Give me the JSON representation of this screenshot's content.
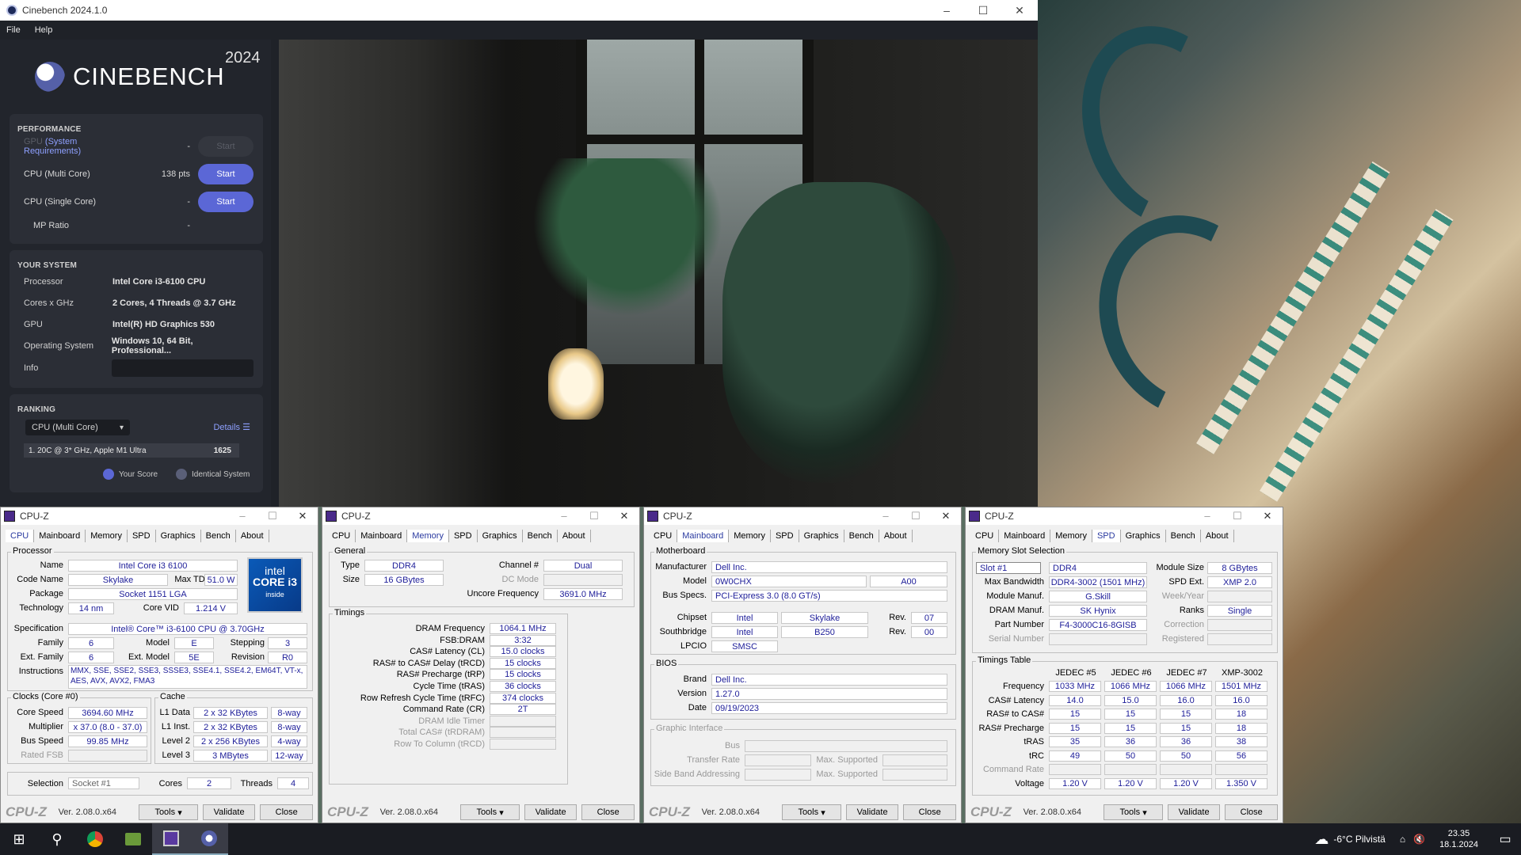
{
  "cinebench": {
    "window_title": "Cinebench 2024.1.0",
    "menu": [
      "File",
      "Help"
    ],
    "logo_text": "CINEBENCH",
    "logo_year": "2024",
    "performance": {
      "heading": "PERFORMANCE",
      "gpu_label": "GPU",
      "gpu_link": "(System Requirements)",
      "gpu_value": "-",
      "gpu_button": "Start",
      "multi_label": "CPU (Multi Core)",
      "multi_value": "138 pts",
      "multi_button": "Start",
      "single_label": "CPU (Single Core)",
      "single_value": "-",
      "single_button": "Start",
      "mp_label": "MP Ratio",
      "mp_value": "-"
    },
    "system": {
      "heading": "YOUR SYSTEM",
      "rows": [
        {
          "k": "Processor",
          "v": "Intel Core i3-6100 CPU"
        },
        {
          "k": "Cores x GHz",
          "v": "2 Cores, 4 Threads @ 3.7 GHz"
        },
        {
          "k": "GPU",
          "v": "Intel(R) HD Graphics 530"
        },
        {
          "k": "Operating System",
          "v": "Windows 10, 64 Bit, Professional..."
        }
      ],
      "info_label": "Info"
    },
    "ranking": {
      "heading": "RANKING",
      "dropdown": "CPU (Multi Core)",
      "details": "Details",
      "row_label": "1. 20C @ 3* GHz, Apple M1 Ultra",
      "row_score": "1625",
      "legend_your": "Your Score",
      "legend_identical": "Identical System",
      "color_your": "#5b67d6",
      "color_identical": "#5a5f78"
    }
  },
  "cpuz": {
    "title": "CPU-Z",
    "version": "Ver. 2.08.0.x64",
    "tools": "Tools",
    "validate": "Validate",
    "close": "Close",
    "tabs": [
      "CPU",
      "Mainboard",
      "Memory",
      "SPD",
      "Graphics",
      "Bench",
      "About"
    ],
    "cpu": {
      "processor_group": "Processor",
      "name_l": "Name",
      "name": "Intel Core i3 6100",
      "codename_l": "Code Name",
      "codename": "Skylake",
      "maxtdp_l": "Max TDP",
      "maxtdp": "51.0 W",
      "package_l": "Package",
      "package": "Socket 1151 LGA",
      "tech_l": "Technology",
      "tech": "14 nm",
      "corevid_l": "Core VID",
      "corevid": "1.214 V",
      "spec_l": "Specification",
      "spec": "Intel® Core™ i3-6100 CPU @ 3.70GHz",
      "family_l": "Family",
      "family": "6",
      "model_l": "Model",
      "model": "E",
      "stepping_l": "Stepping",
      "stepping": "3",
      "extfam_l": "Ext. Family",
      "extfam": "6",
      "extmodel_l": "Ext. Model",
      "extmodel": "5E",
      "revision_l": "Revision",
      "revision": "R0",
      "instr_l": "Instructions",
      "instr1": "MMX, SSE, SSE2, SSE3, SSSE3, SSE4.1, SSE4.2, EM64T, VT-x,",
      "instr2": "AES, AVX, AVX2, FMA3",
      "clocks_group": "Clocks (Core #0)",
      "corespeed_l": "Core Speed",
      "corespeed": "3694.60 MHz",
      "mult_l": "Multiplier",
      "mult": "x 37.0 (8.0 - 37.0)",
      "bus_l": "Bus Speed",
      "bus": "99.85 MHz",
      "fsb_l": "Rated FSB",
      "cache_group": "Cache",
      "l1d_l": "L1 Data",
      "l1d": "2 x 32 KBytes",
      "l1d_w": "8-way",
      "l1i_l": "L1 Inst.",
      "l1i": "2 x 32 KBytes",
      "l1i_w": "8-way",
      "l2_l": "Level 2",
      "l2": "2 x 256 KBytes",
      "l2_w": "4-way",
      "l3_l": "Level 3",
      "l3": "3 MBytes",
      "l3_w": "12-way",
      "sel_l": "Selection",
      "sel": "Socket #1",
      "cores_l": "Cores",
      "cores": "2",
      "threads_l": "Threads",
      "threads": "4",
      "logo_line1": "intel",
      "logo_line2": "CORE i3",
      "logo_line3": "inside"
    },
    "memory": {
      "general_group": "General",
      "type_l": "Type",
      "type": "DDR4",
      "channel_l": "Channel #",
      "channel": "Dual",
      "size_l": "Size",
      "size": "16 GBytes",
      "dc_l": "DC Mode",
      "uncore_l": "Uncore Frequency",
      "uncore": "3691.0 MHz",
      "timings_group": "Timings",
      "rows": [
        {
          "l": "DRAM Frequency",
          "v": "1064.1 MHz"
        },
        {
          "l": "FSB:DRAM",
          "v": "3:32"
        },
        {
          "l": "CAS# Latency (CL)",
          "v": "15.0 clocks"
        },
        {
          "l": "RAS# to CAS# Delay (tRCD)",
          "v": "15 clocks"
        },
        {
          "l": "RAS# Precharge (tRP)",
          "v": "15 clocks"
        },
        {
          "l": "Cycle Time (tRAS)",
          "v": "36 clocks"
        },
        {
          "l": "Row Refresh Cycle Time (tRFC)",
          "v": "374 clocks"
        },
        {
          "l": "Command Rate (CR)",
          "v": "2T"
        },
        {
          "l": "DRAM Idle Timer",
          "v": ""
        },
        {
          "l": "Total CAS# (tRDRAM)",
          "v": ""
        },
        {
          "l": "Row To Column (tRCD)",
          "v": ""
        }
      ]
    },
    "mainboard": {
      "mb_group": "Motherboard",
      "manuf_l": "Manufacturer",
      "manuf": "Dell Inc.",
      "model_l": "Model",
      "model": "0W0CHX",
      "model_rev": "A00",
      "busspec_l": "Bus Specs.",
      "busspec": "PCI-Express 3.0 (8.0 GT/s)",
      "chipset_l": "Chipset",
      "chipset": "Intel",
      "chipset2": "Skylake",
      "rev_l": "Rev.",
      "chipset_rev": "07",
      "south_l": "Southbridge",
      "south": "Intel",
      "south2": "B250",
      "south_rev": "00",
      "lpcio_l": "LPCIO",
      "lpcio": "SMSC",
      "bios_group": "BIOS",
      "brand_l": "Brand",
      "brand": "Dell Inc.",
      "ver_l": "Version",
      "ver": "1.27.0",
      "date_l": "Date",
      "date": "09/19/2023",
      "gi_group": "Graphic Interface",
      "gi_bus": "Bus",
      "gi_tr": "Transfer Rate",
      "gi_ms": "Max. Supported",
      "gi_sba": "Side Band Addressing"
    },
    "spd": {
      "slot_group": "Memory Slot Selection",
      "slot": "Slot #1",
      "type": "DDR4",
      "modsize_l": "Module Size",
      "modsize": "8 GBytes",
      "maxbw_l": "Max Bandwidth",
      "maxbw": "DDR4-3002 (1501 MHz)",
      "spdext_l": "SPD Ext.",
      "spdext": "XMP 2.0",
      "modmanuf_l": "Module Manuf.",
      "modmanuf": "G.Skill",
      "week_l": "Week/Year",
      "drammanuf_l": "DRAM Manuf.",
      "drammanuf": "SK Hynix",
      "ranks_l": "Ranks",
      "ranks": "Single",
      "part_l": "Part Number",
      "part": "F4-3000C16-8GISB",
      "corr_l": "Correction",
      "serial_l": "Serial Number",
      "reg_l": "Registered",
      "timings_group": "Timings Table",
      "cols": [
        "JEDEC #5",
        "JEDEC #6",
        "JEDEC #7",
        "XMP-3002"
      ],
      "rows": [
        {
          "l": "Frequency",
          "v": [
            "1033 MHz",
            "1066 MHz",
            "1066 MHz",
            "1501 MHz"
          ]
        },
        {
          "l": "CAS# Latency",
          "v": [
            "14.0",
            "15.0",
            "16.0",
            "16.0"
          ]
        },
        {
          "l": "RAS# to CAS#",
          "v": [
            "15",
            "15",
            "15",
            "18"
          ]
        },
        {
          "l": "RAS# Precharge",
          "v": [
            "15",
            "15",
            "15",
            "18"
          ]
        },
        {
          "l": "tRAS",
          "v": [
            "35",
            "36",
            "36",
            "38"
          ]
        },
        {
          "l": "tRC",
          "v": [
            "49",
            "50",
            "50",
            "56"
          ]
        },
        {
          "l": "Command Rate",
          "v": [
            "",
            "",
            "",
            ""
          ]
        },
        {
          "l": "Voltage",
          "v": [
            "1.20 V",
            "1.20 V",
            "1.20 V",
            "1.350 V"
          ]
        }
      ]
    }
  },
  "taskbar": {
    "weather": "-6°C  Pilvistä",
    "time": "23.35",
    "date": "18.1.2024"
  }
}
